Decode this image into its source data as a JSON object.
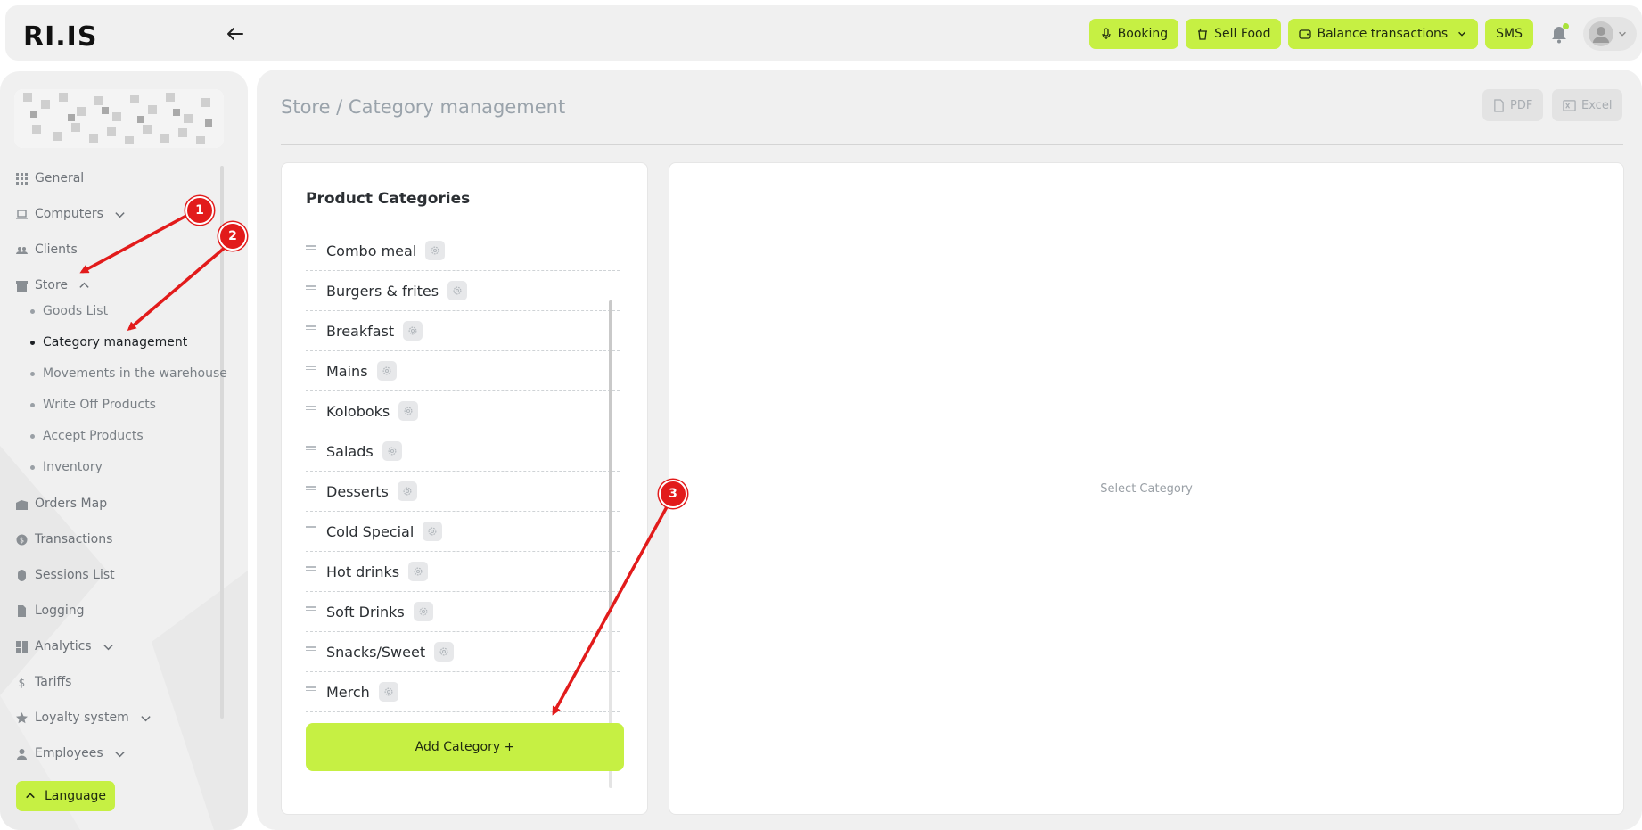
{
  "header": {
    "logo_text": "RI.IS",
    "actions": [
      {
        "label": "Booking",
        "icon": "microphone-icon"
      },
      {
        "label": "Sell Food",
        "icon": "cup-icon"
      },
      {
        "label": "Balance transactions",
        "icon": "wallet-icon"
      },
      {
        "label": "SMS"
      }
    ]
  },
  "sidebar": {
    "items": [
      {
        "label": "General",
        "icon": "grid-icon"
      },
      {
        "label": "Computers",
        "icon": "laptop-icon"
      },
      {
        "label": "Clients",
        "icon": "users-icon"
      },
      {
        "label": "Store",
        "icon": "store-icon"
      },
      {
        "label": "Orders Map",
        "icon": "map-icon"
      },
      {
        "label": "Transactions",
        "icon": "coin-icon"
      },
      {
        "label": "Sessions List",
        "icon": "mouse-icon"
      },
      {
        "label": "Logging",
        "icon": "file-icon"
      },
      {
        "label": "Analytics",
        "icon": "dashboard-icon"
      },
      {
        "label": "Tariffs",
        "icon": "dollar-icon"
      },
      {
        "label": "Loyalty system",
        "icon": "star-icon"
      },
      {
        "label": "Employees",
        "icon": "user-icon"
      }
    ],
    "store_sub": [
      {
        "label": "Goods List"
      },
      {
        "label": "Category management"
      },
      {
        "label": "Movements in the warehouse"
      },
      {
        "label": "Write Off Products"
      },
      {
        "label": "Accept Products"
      },
      {
        "label": "Inventory"
      }
    ],
    "language_label": "Language"
  },
  "main": {
    "breadcrumb": "Store / Category management",
    "export_pdf": "PDF",
    "export_excel": "Excel",
    "categories_title": "Product Categories",
    "categories": [
      "Combo meal",
      "Burgers & frites",
      "Breakfast",
      "Mains",
      "Koloboks",
      "Salads",
      "Desserts",
      "Cold Special",
      "Hot drinks",
      "Soft Drinks",
      "Snacks/Sweet",
      "Merch"
    ],
    "add_category_label": "Add Category +",
    "detail_placeholder": "Select Category"
  },
  "annotations": [
    "1",
    "2",
    "3"
  ],
  "colors": {
    "accent": "#c6f043",
    "panel_bg": "#f0f0f0",
    "annotation": "#e21b1b"
  }
}
